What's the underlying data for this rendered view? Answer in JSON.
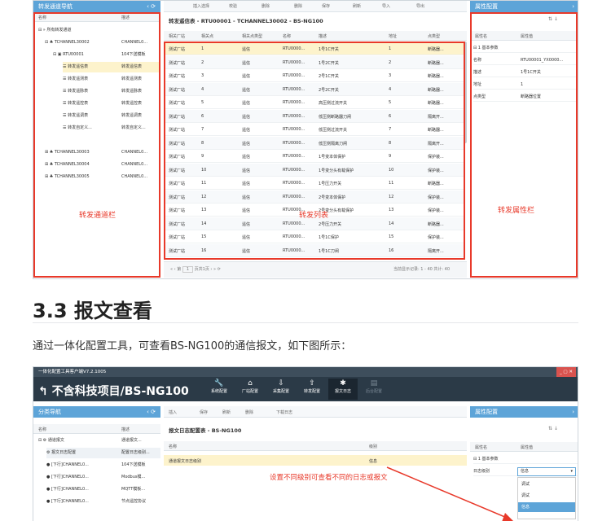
{
  "top": {
    "left_title": "转发通道导航",
    "toolbar": [
      "插入选择",
      "校验",
      "删除",
      "删除",
      "保存",
      "刷新",
      "导入",
      "导出"
    ],
    "prop_title": "属性配置",
    "tree_headers": [
      "名称",
      "描述"
    ],
    "tree_root": "所有转发通道",
    "tree_ch1": {
      "name": "TCHANNEL30002",
      "desc": "CHANNEL0..."
    },
    "tree_rtu": {
      "name": "RTU00001",
      "desc": "104下送模板"
    },
    "tree_sub": [
      {
        "name": "转发遥信表",
        "desc": "转发遥信表"
      },
      {
        "name": "转发遥测表",
        "desc": "转发遥测表"
      },
      {
        "name": "转发遥脉表",
        "desc": "转发遥脉表"
      },
      {
        "name": "转发遥控表",
        "desc": "转发遥控表"
      },
      {
        "name": "转发遥调表",
        "desc": "转发遥调表"
      },
      {
        "name": "转发自定义...",
        "desc": "转发自定义..."
      }
    ],
    "tree_others": [
      {
        "name": "TCHANNEL30003",
        "desc": "CHANNEL0..."
      },
      {
        "name": "TCHANNEL30004",
        "desc": "CHANNEL0..."
      },
      {
        "name": "TCHANNEL30005",
        "desc": "CHANNEL0..."
      }
    ],
    "table_title": "转发遥信表 - RTU00001 - TCHANNEL30002 - BS-NG100",
    "table_headers": [
      "相关厂站",
      "相关点",
      "相关点类型",
      "名称",
      "描述",
      "地址",
      "点类型"
    ],
    "rows": [
      [
        "测试厂站",
        "1",
        "遥信",
        "RTU0000...",
        "1号1C开关",
        "1",
        "断路器..."
      ],
      [
        "测试厂站",
        "2",
        "遥信",
        "RTU0000...",
        "1号2C开关",
        "2",
        "断路器..."
      ],
      [
        "测试厂站",
        "3",
        "遥信",
        "RTU0000...",
        "2号1C开关",
        "3",
        "断路器..."
      ],
      [
        "测试厂站",
        "4",
        "遥信",
        "RTU0000...",
        "2号2C开关",
        "4",
        "断路器..."
      ],
      [
        "测试厂站",
        "5",
        "遥信",
        "RTU0000...",
        "高压侧过流开关",
        "5",
        "断路器..."
      ],
      [
        "测试厂站",
        "6",
        "遥信",
        "RTU0000...",
        "低压侧断路器刀闸",
        "6",
        "隔离开..."
      ],
      [
        "测试厂站",
        "7",
        "遥信",
        "RTU0000...",
        "低压侧过流开关",
        "7",
        "断路器..."
      ],
      [
        "测试厂站",
        "8",
        "遥信",
        "RTU0000...",
        "低压侧隔离刀闸",
        "8",
        "隔离开..."
      ],
      [
        "测试厂站",
        "9",
        "遥信",
        "RTU0000...",
        "1号变本体保护",
        "9",
        "保护装..."
      ],
      [
        "测试厂站",
        "10",
        "遥信",
        "RTU0000...",
        "1号变分头有载保护",
        "10",
        "保护装..."
      ],
      [
        "测试厂站",
        "11",
        "遥信",
        "RTU0000...",
        "1号压力开关",
        "11",
        "断路器..."
      ],
      [
        "测试厂站",
        "12",
        "遥信",
        "RTU0000...",
        "2号变本体保护",
        "12",
        "保护装..."
      ],
      [
        "测试厂站",
        "13",
        "遥信",
        "RTU0000...",
        "2号变分头有载保护",
        "13",
        "保护装..."
      ],
      [
        "测试厂站",
        "14",
        "遥信",
        "RTU0000...",
        "2号压力开关",
        "14",
        "断路器..."
      ],
      [
        "测试厂站",
        "15",
        "遥信",
        "RTU0000...",
        "1号1C保护",
        "15",
        "保护装..."
      ],
      [
        "测试厂站",
        "16",
        "遥信",
        "RTU0000...",
        "1号1C刀闸",
        "16",
        "隔离开..."
      ]
    ],
    "pager_page": "第",
    "pager_num": "1",
    "pager_total": "页共1页",
    "pager_info": "当前显示记录: 1 - 40 共计: 40",
    "prop_headers": [
      "属性名",
      "属性值"
    ],
    "prop_group": "1 基本参数",
    "props": [
      {
        "k": "名称",
        "v": "RTU00001_YX0000..."
      },
      {
        "k": "描述",
        "v": "1号1C开关"
      },
      {
        "k": "地址",
        "v": "1"
      },
      {
        "k": "点类型",
        "v": "断路器位置"
      }
    ],
    "label_left": "转发通道栏",
    "label_mid": "转发列表",
    "label_right": "转发属性栏"
  },
  "section": {
    "heading": "3.3 报文查看",
    "paragraph": "通过一体化配置工具，可查看BS-NG100的通信报文，如下图所示："
  },
  "bottom": {
    "window_title": "一体化配置工具客户端V7.2.1005",
    "project": "不含科技项目/BS-NG100",
    "nav": [
      "系统配置",
      "厂站配置",
      "采集配置",
      "转发配置",
      "报文日志",
      "后台配置"
    ],
    "left_title": "分类导航",
    "tree_headers": [
      "名称",
      "描述"
    ],
    "tree_root": "通道报文",
    "tree_root_desc": "通道报文...",
    "tree_items": [
      {
        "name": "报文日志配置",
        "desc": "配置日志级别..."
      },
      {
        "name": "[下行]CHANNEL0...",
        "desc": "104下送模板"
      },
      {
        "name": "[下行]CHANNEL0...",
        "desc": "Modbus模..."
      },
      {
        "name": "[下行]CHANNEL0...",
        "desc": "MQTT模板..."
      },
      {
        "name": "[下行]CHANNEL0...",
        "desc": "节点遥控协议"
      }
    ],
    "toolbar": [
      "插入",
      "保存",
      "刷新",
      "删除",
      "下载日志"
    ],
    "table_title": "报文日志配置表 - BS-NG100",
    "table_headers": [
      "名称",
      "级别"
    ],
    "row": [
      "通道报文日志级别",
      "信息"
    ],
    "prop_title": "属性配置",
    "prop_headers": [
      "属性名",
      "属性值"
    ],
    "prop_group": "1 基本参数",
    "prop_key": "日志级别",
    "prop_val": "信息",
    "options": [
      "调试",
      "调试",
      "信息"
    ],
    "annotation": "设置不同级别可查看不同的日志或报文"
  }
}
